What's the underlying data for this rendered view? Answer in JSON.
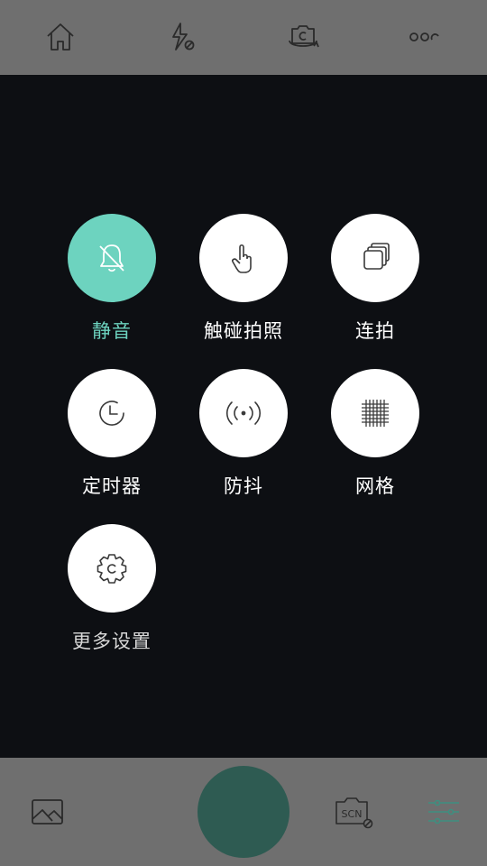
{
  "top_bar": {
    "icons": [
      "home-icon",
      "flash-off-icon",
      "switch-camera-icon",
      "more-icon"
    ]
  },
  "options": [
    {
      "label": "静音",
      "icon": "mute-bell-icon",
      "active": true
    },
    {
      "label": "触碰拍照",
      "icon": "touch-hand-icon",
      "active": false
    },
    {
      "label": "连拍",
      "icon": "burst-stack-icon",
      "active": false
    },
    {
      "label": "定时器",
      "icon": "timer-clock-icon",
      "active": false
    },
    {
      "label": "防抖",
      "icon": "stabilization-icon",
      "active": false
    },
    {
      "label": "网格",
      "icon": "grid-icon",
      "active": false
    },
    {
      "label": "更多设置",
      "icon": "settings-gear-icon",
      "active": false
    }
  ],
  "bottom_bar": {
    "icons": [
      "gallery-icon",
      "shutter-button",
      "scene-off-icon",
      "settings-sliders-icon"
    ],
    "scene_text": "SCN"
  },
  "colors": {
    "bars": "#6f6f6f",
    "panel": "#0d0f13",
    "accent": "#6dd3bf",
    "shutter": "#2e5b52"
  }
}
